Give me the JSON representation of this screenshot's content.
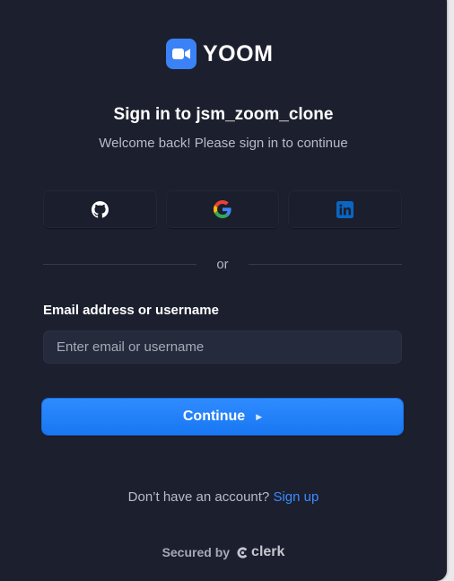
{
  "logo": {
    "text": "YOOM",
    "icon": "video-camera-icon",
    "badge_color": "#3b82f6"
  },
  "header": {
    "title": "Sign in to jsm_zoom_clone",
    "subtitle": "Welcome back! Please sign in to continue"
  },
  "social": [
    {
      "provider": "github",
      "icon": "github-icon"
    },
    {
      "provider": "google",
      "icon": "google-icon"
    },
    {
      "provider": "linkedin",
      "icon": "linkedin-icon"
    }
  ],
  "divider": {
    "text": "or"
  },
  "form": {
    "email_label": "Email address or username",
    "email_placeholder": "Enter email or username",
    "email_value": "",
    "continue_label": "Continue",
    "continue_icon": "triangle-right-icon"
  },
  "footer": {
    "signup_prompt": "Don’t have an account?",
    "signup_link": "Sign up",
    "secured_by": "Secured by",
    "brand": "clerk"
  },
  "colors": {
    "card_bg": "#1c1f2e",
    "input_bg": "#252a3d",
    "accent": "#1877f2",
    "link": "#3b8bff"
  }
}
